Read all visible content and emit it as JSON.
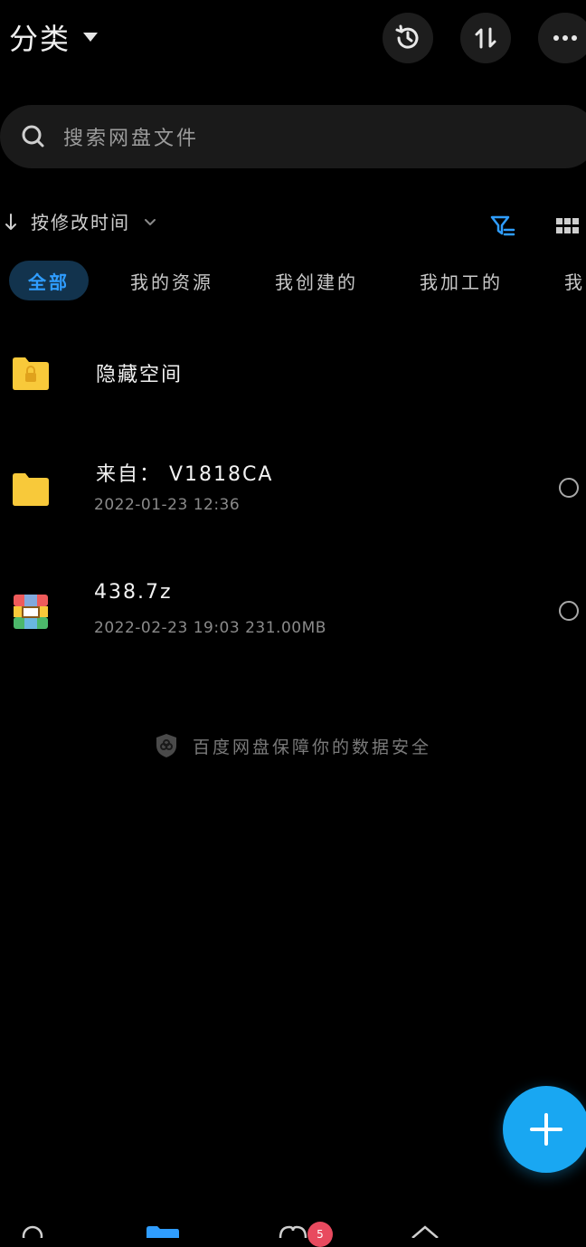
{
  "header": {
    "title": "分类",
    "icons": [
      "history-icon",
      "sort-transfer-icon",
      "more-icon"
    ]
  },
  "search": {
    "placeholder": "搜索网盘文件"
  },
  "sort": {
    "label": "按修改时间"
  },
  "tabs": [
    {
      "label": "全部",
      "active": true
    },
    {
      "label": "我的资源"
    },
    {
      "label": "我创建的"
    },
    {
      "label": "我加工的"
    },
    {
      "label": "我"
    }
  ],
  "files": [
    {
      "name": "隐藏空间",
      "meta": "",
      "icon": "lock-folder-icon"
    },
    {
      "name": "来自： V1818CA",
      "meta": "2022-01-23   12:36",
      "icon": "folder-icon"
    },
    {
      "name": "438.7z",
      "meta": "2022-02-23   19:03   231.00MB",
      "icon": "archive-icon"
    }
  ],
  "footer": {
    "safety_text": "百度网盘保障你的数据安全"
  },
  "bottom_nav": {
    "badge_count": "5"
  },
  "colors": {
    "accent": "#19a7f2",
    "folder": "#f8c93a",
    "background": "#000000"
  }
}
